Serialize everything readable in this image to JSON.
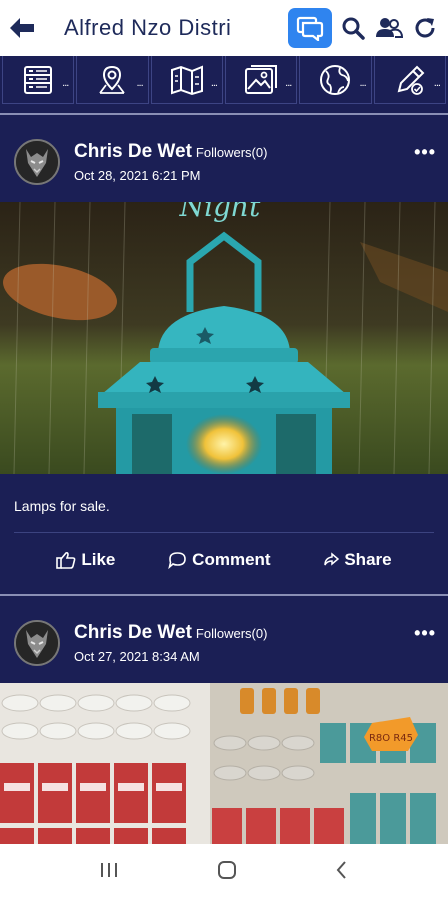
{
  "header": {
    "title": "Alfred Nzo Distri",
    "back_icon": "back-arrow-icon",
    "chat_icon": "chat-icon",
    "search_icon": "search-icon",
    "people_icon": "people-icon",
    "refresh_icon": "refresh-icon",
    "accent_color": "#2f84ef"
  },
  "menu": {
    "items": [
      {
        "icon": "list-icon",
        "dots": "..."
      },
      {
        "icon": "location-pin-icon",
        "dots": "..."
      },
      {
        "icon": "map-icon",
        "dots": "..."
      },
      {
        "icon": "gallery-icon",
        "dots": "..."
      },
      {
        "icon": "globe-icon",
        "dots": "..."
      },
      {
        "icon": "edit-icon",
        "dots": "..."
      }
    ]
  },
  "posts": [
    {
      "author": "Chris De Wet",
      "followers": "Followers(0)",
      "date": "Oct 28, 2021 6:21 PM",
      "more": "•••",
      "image_text": "Night",
      "caption": "Lamps for sale.",
      "actions": {
        "like": "Like",
        "comment": "Comment",
        "share": "Share"
      }
    },
    {
      "author": "Chris De Wet",
      "followers": "Followers(0)",
      "date": "Oct 27, 2021 8:34 AM",
      "more": "•••",
      "price_tag": "R8O R45"
    }
  ],
  "theme": {
    "background": "#1b1f55",
    "separator": "#8a8fb5"
  }
}
